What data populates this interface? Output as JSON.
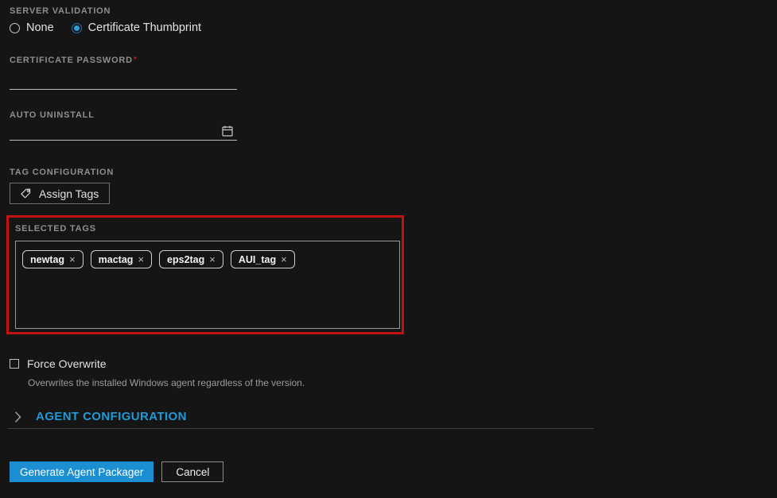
{
  "page": {
    "background": "#151515",
    "accent_blue": "#1e9ad9",
    "button_blue": "#1b8fd2",
    "highlight_red": "#c11212"
  },
  "server_validation": {
    "label": "SERVER VALIDATION",
    "options": [
      {
        "label": "None",
        "selected": false
      },
      {
        "label": "Certificate Thumbprint",
        "selected": true
      }
    ]
  },
  "certificate_password": {
    "label": "CERTIFICATE PASSWORD",
    "required_mark": "*",
    "value": "",
    "placeholder": ""
  },
  "auto_uninstall": {
    "label": "AUTO UNINSTALL",
    "value": "",
    "placeholder": "",
    "icon": "calendar-icon"
  },
  "tag_configuration": {
    "label": "TAG CONFIGURATION",
    "assign_button_label": "Assign Tags"
  },
  "selected_tags": {
    "label": "SELECTED TAGS",
    "remove_glyph": "×",
    "tags": [
      "newtag",
      "mactag",
      "eps2tag",
      "AUI_tag"
    ]
  },
  "force_overwrite": {
    "label": "Force Overwrite",
    "checked": false,
    "description": "Overwrites the installed Windows agent regardless of the version."
  },
  "agent_configuration": {
    "chevron": "›",
    "label": "AGENT CONFIGURATION"
  },
  "footer": {
    "generate_label": "Generate Agent Packager",
    "cancel_label": "Cancel"
  }
}
